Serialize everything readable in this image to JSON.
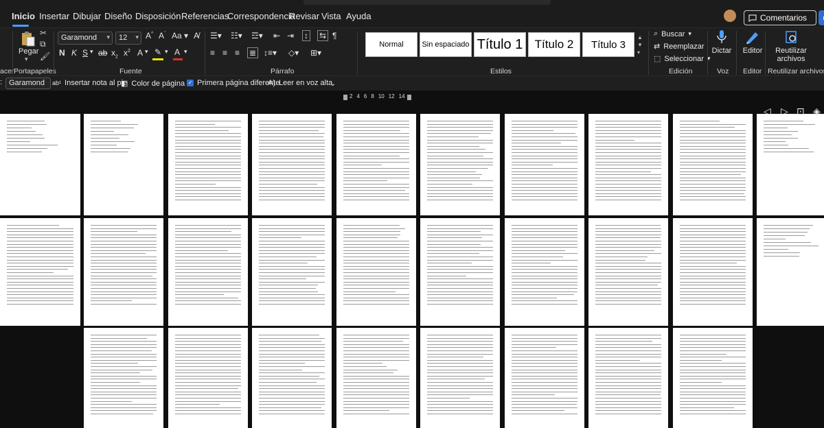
{
  "menu": {
    "tabs": [
      "Inicio",
      "Insertar",
      "Dibujar",
      "Diseño",
      "Disposición",
      "Referencias",
      "Correspondencia",
      "Revisar",
      "Vista",
      "Ayuda"
    ],
    "active": "Inicio",
    "comments_label": "Comentarios"
  },
  "ribbon": {
    "clipboard": {
      "paste_label": "Pegar",
      "group_label": "Portapapeles"
    },
    "font": {
      "name": "Garamond",
      "size": "12",
      "group_label": "Fuente"
    },
    "paragraph": {
      "group_label": "Párrafo"
    },
    "styles": {
      "items": [
        "Normal",
        "Sin espaciado",
        "Título 1",
        "Título 2",
        "Título 3"
      ],
      "group_label": "Estilos"
    },
    "editing": {
      "find_label": "Buscar",
      "replace_label": "Reemplazar",
      "select_label": "Seleccionar",
      "group_label": "Edición"
    },
    "voice": {
      "dictate_label": "Dictar",
      "group_label": "Voz"
    },
    "editor": {
      "label": "Editor",
      "group_label": "Editor"
    },
    "reuse": {
      "label_line1": "Reutilizar",
      "label_line2": "archivos",
      "group_label": "Reutilizar archivos"
    },
    "left_cut_label": "acer"
  },
  "toolbar2": {
    "font_name": "Garamond",
    "footnote_label": "Insertar nota al pie",
    "page_color_label": "Color de página",
    "first_page_label": "Primera página diferente",
    "read_aloud_label": "Leer en voz alta"
  },
  "ruler": {
    "numbers": [
      "2",
      "4",
      "6",
      "8",
      "10",
      "12",
      "14"
    ]
  },
  "colors": {
    "accent": "#2f6fd1",
    "underline": "#4ca0ff",
    "highlight": "#f2e600",
    "font_color": "#e03030"
  }
}
